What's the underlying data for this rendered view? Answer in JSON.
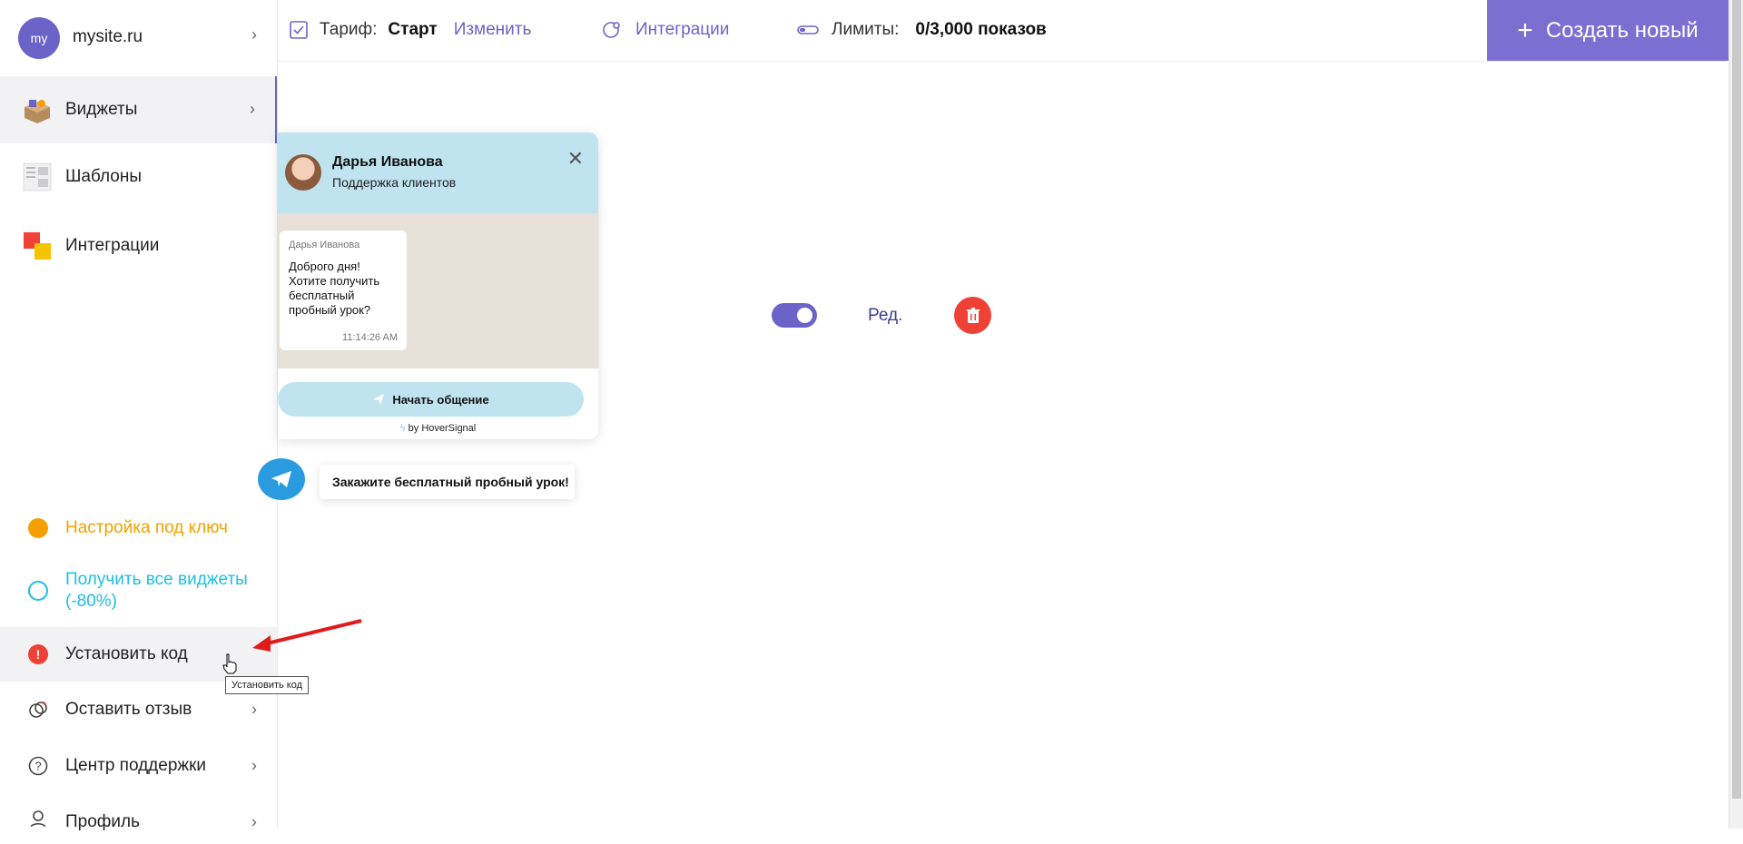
{
  "sidebar": {
    "avatar_text": "my",
    "site_name": "mysite.ru",
    "nav": [
      {
        "label": "Виджеты",
        "icon": "widgets-box-icon"
      },
      {
        "label": "Шаблоны",
        "icon": "templates-icon"
      },
      {
        "label": "Интеграции",
        "icon": "integrations-icon"
      }
    ],
    "bottom": [
      {
        "label": "Настройка под ключ",
        "color": "#f5a000"
      },
      {
        "label_line1": "Получить все виджеты",
        "label_line2": "(-80%)",
        "color": "#1fbfe4"
      },
      {
        "label": "Установить код",
        "color": "#ef4136"
      },
      {
        "label": "Оставить отзыв"
      },
      {
        "label": "Центр поддержки"
      },
      {
        "label": "Профиль"
      }
    ],
    "tooltip": "Установить код"
  },
  "topbar": {
    "tariff_label": "Тариф:",
    "tariff_value": "Старт",
    "change_link": "Изменить",
    "integrations_link": "Интеграции",
    "limits_label": "Лимиты:",
    "limits_value": "0/3,000 показов",
    "create_button": "Создать новый"
  },
  "widget": {
    "agent_name": "Дарья Иванова",
    "agent_role": "Поддержка клиентов",
    "bubble_author": "Дарья Иванова",
    "bubble_text": "Доброго дня! Хотите получить бесплатный пробный урок?",
    "bubble_time": "11:14:26 AM",
    "start_button": "Начать общение",
    "powered_by": "by HoverSignal",
    "promo_text": "Закажите бесплатный пробный урок!"
  },
  "controls": {
    "edit_link": "Ред.",
    "toggle_on": true
  },
  "colors": {
    "accent": "#6c63c9",
    "create_button_bg": "#7b6fd2",
    "delete": "#ef4136",
    "widget_header": "#bfe4ef"
  }
}
